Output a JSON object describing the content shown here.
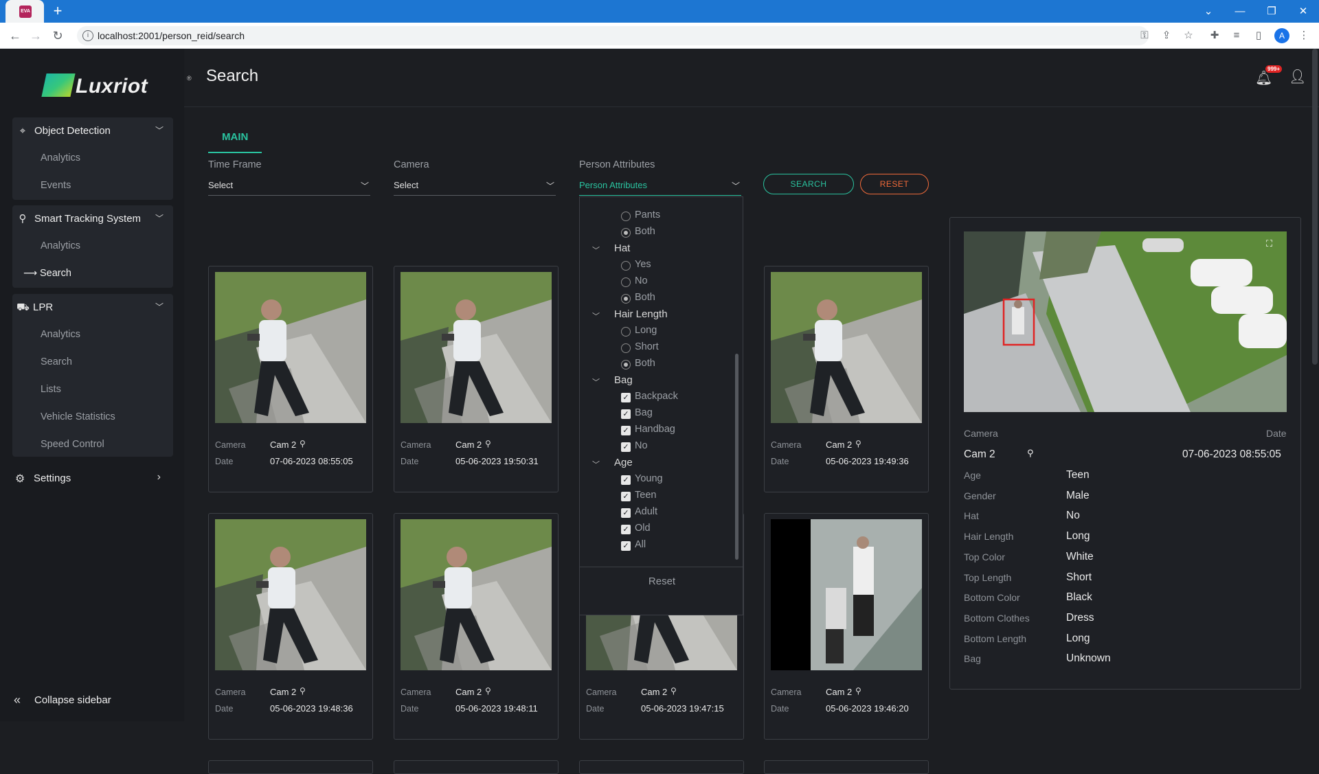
{
  "browser": {
    "favicon_text": "EVA",
    "new_tab": "+",
    "url": "localhost:2001/person_reid/search",
    "profile_initial": "A"
  },
  "app": {
    "brand": "Luxriot",
    "brand_mark": "®",
    "page_title": "Search",
    "notification_count": "999+"
  },
  "sidebar": {
    "groups": [
      {
        "label": "Object Detection",
        "items": [
          "Analytics",
          "Events"
        ]
      },
      {
        "label": "Smart Tracking System",
        "items": [
          "Analytics",
          "Search"
        ]
      },
      {
        "label": "LPR",
        "items": [
          "Analytics",
          "Search",
          "Lists",
          "Vehicle Statistics",
          "Speed Control"
        ]
      }
    ],
    "active_item": "Search",
    "settings": "Settings",
    "collapse": "Collapse sidebar"
  },
  "tabs": {
    "main": "MAIN"
  },
  "filters": {
    "time_frame": {
      "label": "Time Frame",
      "value": "Select"
    },
    "camera": {
      "label": "Camera",
      "value": "Select"
    },
    "person_attributes": {
      "label": "Person Attributes",
      "value": "Person Attributes"
    }
  },
  "buttons": {
    "search": "SEARCH",
    "reset": "RESET"
  },
  "dropdown": {
    "top_options": [
      {
        "label": "Pants",
        "checked": false
      },
      {
        "label": "Both",
        "checked": true
      }
    ],
    "groups": [
      {
        "label": "Hat",
        "type": "radio",
        "options": [
          {
            "label": "Yes",
            "checked": false
          },
          {
            "label": "No",
            "checked": false
          },
          {
            "label": "Both",
            "checked": true
          }
        ]
      },
      {
        "label": "Hair Length",
        "type": "radio",
        "options": [
          {
            "label": "Long",
            "checked": false
          },
          {
            "label": "Short",
            "checked": false
          },
          {
            "label": "Both",
            "checked": true
          }
        ]
      },
      {
        "label": "Bag",
        "type": "checkbox",
        "options": [
          {
            "label": "Backpack",
            "checked": true
          },
          {
            "label": "Bag",
            "checked": true
          },
          {
            "label": "Handbag",
            "checked": true
          },
          {
            "label": "No",
            "checked": true
          }
        ]
      },
      {
        "label": "Age",
        "type": "checkbox",
        "options": [
          {
            "label": "Young",
            "checked": true
          },
          {
            "label": "Teen",
            "checked": true
          },
          {
            "label": "Adult",
            "checked": true
          },
          {
            "label": "Old",
            "checked": true
          },
          {
            "label": "All",
            "checked": true
          }
        ]
      }
    ],
    "reset": "Reset"
  },
  "results": {
    "camera_label": "Camera",
    "date_label": "Date",
    "cards": [
      {
        "camera": "Cam 2",
        "date": "07-06-2023 08:55:05"
      },
      {
        "camera": "Cam 2",
        "date": "05-06-2023 19:50:31"
      },
      {
        "camera": "Cam 2",
        "date": "05-06-2023 19:49:36"
      },
      {
        "camera": "Cam 2",
        "date": "05-06-2023 19:48:36"
      },
      {
        "camera": "Cam 2",
        "date": "05-06-2023 19:48:11"
      },
      {
        "camera": "Cam 2",
        "date": "05-06-2023 19:47:15"
      },
      {
        "camera": "Cam 2",
        "date": "05-06-2023 19:46:20"
      }
    ]
  },
  "detail": {
    "camera_label": "Camera",
    "date_label": "Date",
    "camera": "Cam 2",
    "date": "07-06-2023 08:55:05",
    "attributes": [
      {
        "label": "Age",
        "value": "Teen"
      },
      {
        "label": "Gender",
        "value": "Male"
      },
      {
        "label": "Hat",
        "value": "No"
      },
      {
        "label": "Hair Length",
        "value": "Long"
      },
      {
        "label": "Top Color",
        "value": "White"
      },
      {
        "label": "Top Length",
        "value": "Short"
      },
      {
        "label": "Bottom Color",
        "value": "Black"
      },
      {
        "label": "Bottom Clothes",
        "value": "Dress"
      },
      {
        "label": "Bottom Length",
        "value": "Long"
      },
      {
        "label": "Bag",
        "value": "Unknown"
      }
    ]
  },
  "colors": {
    "accent": "#2ac4a0",
    "reset": "#f26b3a",
    "background": "#1c1e22",
    "badge": "#e02424"
  }
}
